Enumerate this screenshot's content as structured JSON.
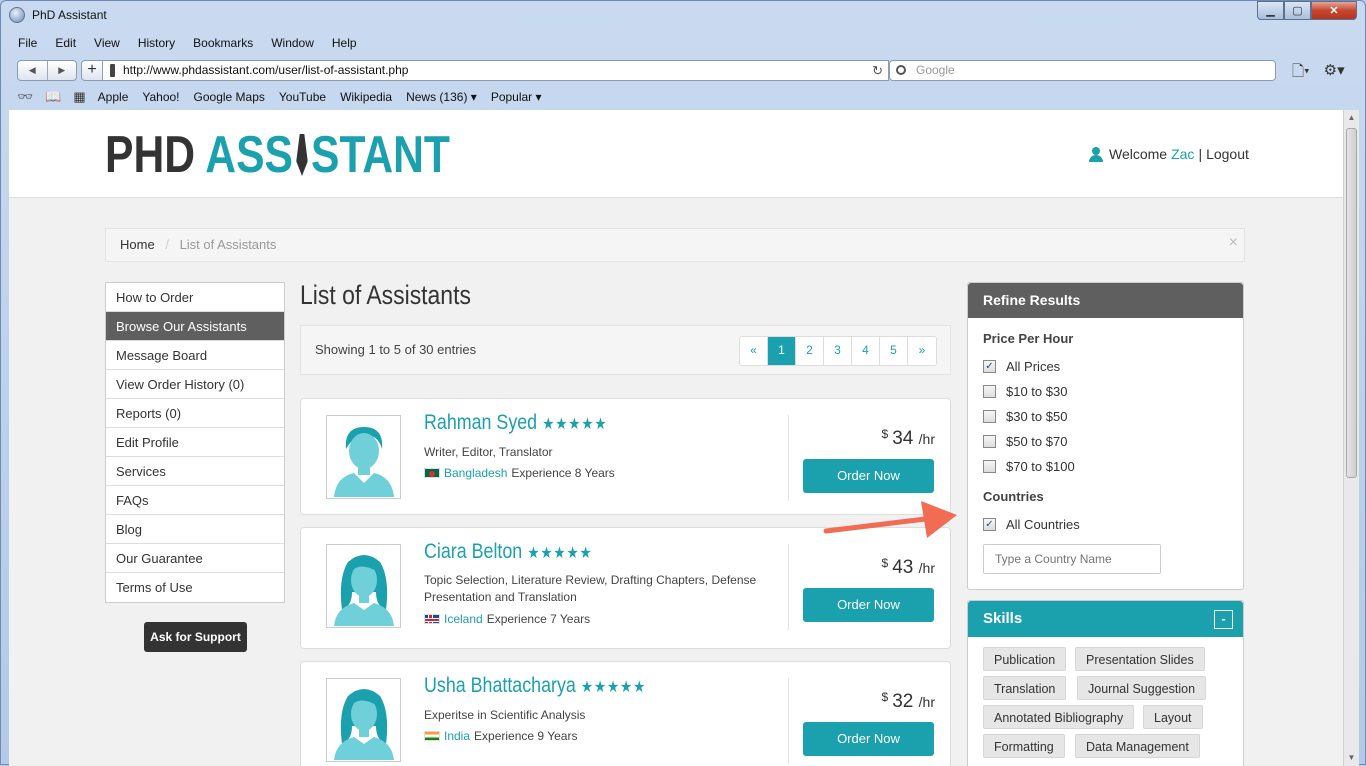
{
  "window": {
    "title": "PhD Assistant"
  },
  "menu": [
    "File",
    "Edit",
    "View",
    "History",
    "Bookmarks",
    "Window",
    "Help"
  ],
  "toolbar": {
    "url": "http://www.phdassistant.com/user/list-of-assistant.php",
    "search_placeholder": "Google"
  },
  "bookmarks": [
    "Apple",
    "Yahoo!",
    "Google Maps",
    "YouTube",
    "Wikipedia",
    "News (136) ▾",
    "Popular ▾"
  ],
  "header": {
    "logo_part1": "PHD",
    "logo_part2a": "ASS",
    "logo_part2b": "STANT",
    "welcome": "Welcome",
    "username": "Zac",
    "separator": "|",
    "logout": "Logout"
  },
  "breadcrumb": {
    "home": "Home",
    "sep": "/",
    "current": "List of Assistants",
    "close": "×"
  },
  "sidenav": {
    "items": [
      "How to Order",
      "Browse Our Assistants",
      "Message Board",
      "View Order History (0)",
      "Reports (0)",
      "Edit Profile",
      "Services",
      "FAQs",
      "Blog",
      "Our Guarantee",
      "Terms of Use"
    ],
    "active_index": 1,
    "support_label": "Ask for Support"
  },
  "main": {
    "title": "List of Assistants",
    "showing": "Showing 1 to 5 of 30 entries",
    "pager": [
      "«",
      "1",
      "2",
      "3",
      "4",
      "5",
      "»"
    ],
    "current_page": "1"
  },
  "assistants": [
    {
      "name": "Rahman Syed",
      "stars": "★★★★★",
      "desc": "Writer, Editor, Translator",
      "country": "Bangladesh",
      "experience": "Experience 8 Years",
      "currency": "$",
      "price": "34",
      "unit": "/hr",
      "order": "Order Now",
      "gender": "male",
      "flag": "bangladesh"
    },
    {
      "name": "Ciara Belton",
      "stars": "★★★★★",
      "desc": "Topic Selection, Literature Review, Drafting Chapters, Defense Presentation and Translation",
      "country": "Iceland",
      "experience": "Experience 7 Years",
      "currency": "$",
      "price": "43",
      "unit": "/hr",
      "order": "Order Now",
      "gender": "female",
      "flag": "iceland"
    },
    {
      "name": "Usha Bhattacharya",
      "stars": "★★★★★",
      "desc": "Experitse in Scientific Analysis",
      "country": "India",
      "experience": "Experience 9 Years",
      "currency": "$",
      "price": "32",
      "unit": "/hr",
      "order": "Order Now",
      "gender": "female",
      "flag": "india"
    }
  ],
  "refine": {
    "title": "Refine Results",
    "price_title": "Price Per Hour",
    "price_options": [
      {
        "label": "All Prices",
        "checked": true
      },
      {
        "label": "$10 to $30",
        "checked": false
      },
      {
        "label": "$30 to $50",
        "checked": false
      },
      {
        "label": "$50 to $70",
        "checked": false
      },
      {
        "label": "$70 to $100",
        "checked": false
      }
    ],
    "countries_title": "Countries",
    "all_countries": {
      "label": "All Countries",
      "checked": true
    },
    "country_placeholder": "Type a Country Name"
  },
  "skills": {
    "title": "Skills",
    "minimize": "-",
    "tags": [
      "Publication",
      "Presentation Slides",
      "Translation",
      "Journal Suggestion",
      "Annotated Bibliography",
      "Layout",
      "Formatting",
      "Data Management"
    ]
  },
  "colors": {
    "accent": "#1ba0ae",
    "dark": "#333333",
    "nav_active": "#5f5f5f",
    "annotation_arrow": "#f26b53"
  }
}
